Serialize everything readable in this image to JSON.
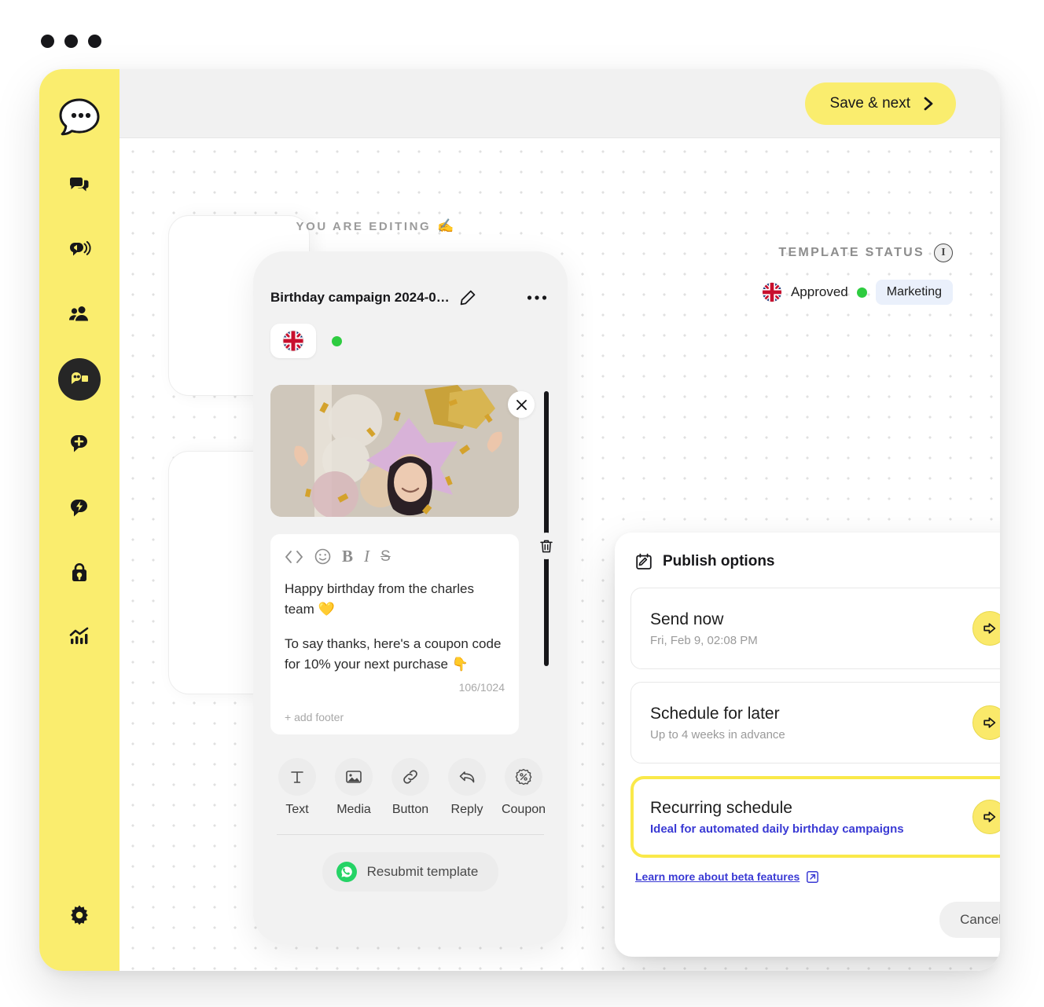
{
  "window": {
    "chrome_dots": 3
  },
  "topbar": {
    "save_next_label": "Save & next",
    "chevron": "›"
  },
  "sidebar": {
    "brand_icon": "chat-bubble-logo",
    "items": [
      {
        "id": "inbox",
        "icon": "chat-bubbles-icon",
        "active": false
      },
      {
        "id": "campaigns",
        "icon": "megaphone-bubble-icon",
        "active": false
      },
      {
        "id": "contacts",
        "icon": "people-icon",
        "active": false
      },
      {
        "id": "templates",
        "icon": "template-bubble-icon",
        "active": true
      },
      {
        "id": "create",
        "icon": "plus-bubble-icon",
        "active": false
      },
      {
        "id": "automation",
        "icon": "lightning-bubble-icon",
        "active": false
      },
      {
        "id": "shop",
        "icon": "bag-icon",
        "active": false
      },
      {
        "id": "analytics",
        "icon": "analytics-chart-icon",
        "active": false
      }
    ],
    "bottom_item": {
      "id": "settings",
      "icon": "gear-icon"
    }
  },
  "board": {
    "editing_label": "YOU ARE EDITING",
    "editing_emoji": "✍️"
  },
  "template_card": {
    "title": "Birthday campaign 2024-0…",
    "edit_icon": "pencil-icon",
    "more_icon": "ellipsis-icon",
    "language_flag": "uk-flag",
    "status_dot_color": "#2ECC40",
    "media": {
      "close_icon": "close-icon",
      "alt": "birthday-balloons-photo"
    },
    "editor": {
      "format_buttons": [
        "code-icon",
        "emoji-icon",
        "bold-icon",
        "italic-icon",
        "strikethrough-icon"
      ],
      "paragraphs": [
        "Happy birthday from the charles team 💛",
        "To say thanks, here's a coupon code for 10% your next purchase 👇"
      ],
      "char_count": "106/1024",
      "add_footer_label": "+ add footer",
      "delete_icon": "trash-icon"
    },
    "block_tools": [
      {
        "label": "Text",
        "icon": "text-icon"
      },
      {
        "label": "Media",
        "icon": "image-icon"
      },
      {
        "label": "Button",
        "icon": "link-icon"
      },
      {
        "label": "Reply",
        "icon": "reply-icon"
      },
      {
        "label": "Coupon",
        "icon": "coupon-percent-icon"
      }
    ],
    "resubmit_label": "Resubmit template",
    "resubmit_icon": "whatsapp-icon"
  },
  "template_status": {
    "heading": "TEMPLATE STATUS",
    "info_icon": "info-icon",
    "info_glyph": "i",
    "flag": "uk-flag",
    "state": "Approved",
    "state_dot_color": "#2ECC40",
    "category_pill": "Marketing"
  },
  "publish_options": {
    "title": "Publish options",
    "title_icon": "calendar-edit-icon",
    "options": [
      {
        "id": "send-now",
        "title": "Send now",
        "subtitle": "Fri, Feb 9, 02:08 PM",
        "subtitle_accent": false,
        "highlighted": false,
        "action_icon": "arrow-right-icon"
      },
      {
        "id": "schedule-later",
        "title": "Schedule for later",
        "subtitle": "Up to 4 weeks in advance",
        "subtitle_accent": false,
        "highlighted": false,
        "action_icon": "arrow-right-icon"
      },
      {
        "id": "recurring-schedule",
        "title": "Recurring schedule",
        "subtitle": "Ideal for automated daily birthday campaigns",
        "subtitle_accent": true,
        "highlighted": true,
        "action_icon": "arrow-right-icon"
      }
    ],
    "beta_link_label": "Learn more about beta features",
    "beta_link_icon": "external-link-icon",
    "cancel_label": "Cancel"
  },
  "colors": {
    "brand_yellow": "#FAED6E",
    "accent_yellow": "#FAE96A",
    "highlight_yellow": "#FAE94A",
    "link_blue": "#3A3AD4",
    "status_green": "#2ECC40",
    "whatsapp_green": "#25D366",
    "dark": "#17171A"
  }
}
